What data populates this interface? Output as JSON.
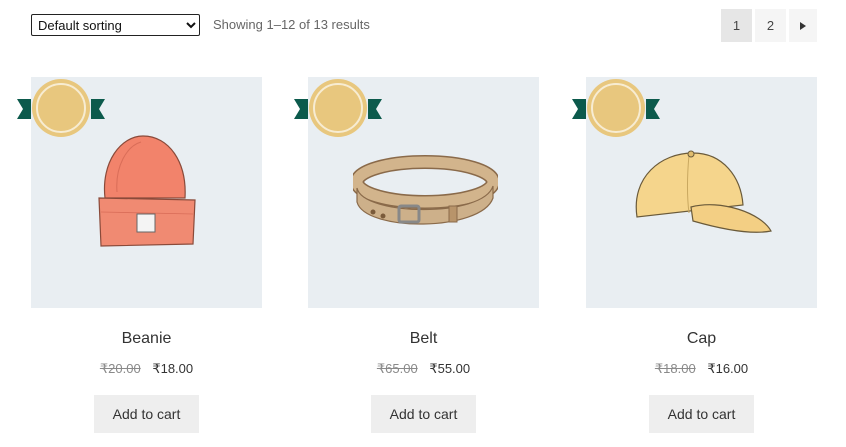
{
  "sorting": {
    "selected": "Default sorting",
    "options": [
      "Default sorting"
    ]
  },
  "result_count": "Showing 1–12 of 13 results",
  "pagination": {
    "pages": [
      "1",
      "2"
    ],
    "current": "1",
    "next_icon": "triangle-right-icon"
  },
  "products": [
    {
      "name": "Beanie",
      "regular_price": "₹20.00",
      "sale_price": "₹18.00",
      "button": "Add to cart",
      "image": "beanie-icon"
    },
    {
      "name": "Belt",
      "regular_price": "₹65.00",
      "sale_price": "₹55.00",
      "button": "Add to cart",
      "image": "belt-icon"
    },
    {
      "name": "Cap",
      "regular_price": "₹18.00",
      "sale_price": "₹16.00",
      "button": "Add to cart",
      "image": "cap-icon"
    }
  ],
  "colors": {
    "badge_gold": "#e8c77e",
    "badge_ribbon": "#0c5a4c",
    "thumb_bg": "#e9eef2",
    "button_bg": "#eeeeee"
  }
}
